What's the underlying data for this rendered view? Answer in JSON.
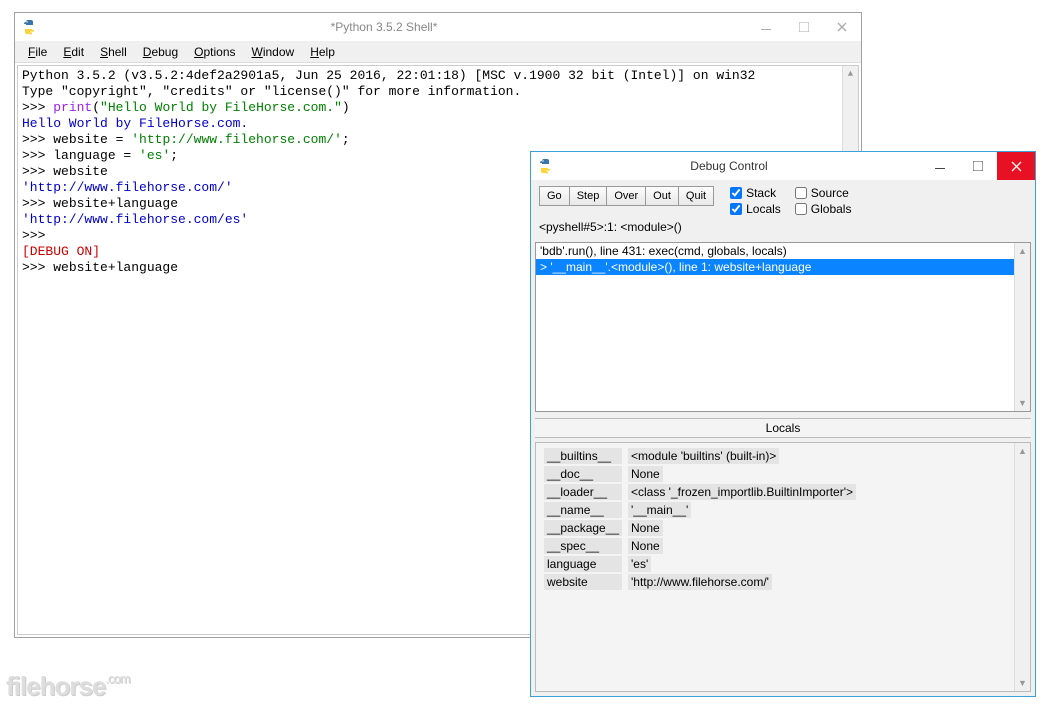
{
  "shell_window": {
    "title": "*Python 3.5.2 Shell*",
    "menus": [
      "File",
      "Edit",
      "Shell",
      "Debug",
      "Options",
      "Window",
      "Help"
    ],
    "lines": [
      [
        {
          "t": "Python 3.5.2 (v3.5.2:4def2a2901a5, Jun 25 2016, 22:01:18) [MSC v.1900 32 bit (Intel)] on win32",
          "c": ""
        }
      ],
      [
        {
          "t": "Type \"copyright\", \"credits\" or \"license()\" for more information.",
          "c": ""
        }
      ],
      [
        {
          "t": ">>> ",
          "c": "prompt"
        },
        {
          "t": "print",
          "c": "func"
        },
        {
          "t": "(",
          "c": ""
        },
        {
          "t": "\"Hello World by FileHorse.com.\"",
          "c": "str"
        },
        {
          "t": ")",
          "c": ""
        }
      ],
      [
        {
          "t": "Hello World by FileHorse.com.",
          "c": "out-blue"
        }
      ],
      [
        {
          "t": ">>> ",
          "c": "prompt"
        },
        {
          "t": "website = ",
          "c": ""
        },
        {
          "t": "'http://www.filehorse.com/'",
          "c": "str"
        },
        {
          "t": ";",
          "c": ""
        }
      ],
      [
        {
          "t": ">>> ",
          "c": "prompt"
        },
        {
          "t": "language = ",
          "c": ""
        },
        {
          "t": "'es'",
          "c": "str"
        },
        {
          "t": ";",
          "c": ""
        }
      ],
      [
        {
          "t": ">>> ",
          "c": "prompt"
        },
        {
          "t": "website",
          "c": ""
        }
      ],
      [
        {
          "t": "'http://www.filehorse.com/'",
          "c": "out-blue"
        }
      ],
      [
        {
          "t": ">>> ",
          "c": "prompt"
        },
        {
          "t": "website+language",
          "c": ""
        }
      ],
      [
        {
          "t": "'http://www.filehorse.com/es'",
          "c": "out-blue"
        }
      ],
      [
        {
          "t": ">>> ",
          "c": "prompt"
        }
      ],
      [
        {
          "t": "[DEBUG ON]",
          "c": "out-red"
        }
      ],
      [
        {
          "t": ">>> ",
          "c": "prompt"
        },
        {
          "t": "website+language",
          "c": ""
        }
      ]
    ]
  },
  "debug_window": {
    "title": "Debug Control",
    "buttons": [
      "Go",
      "Step",
      "Over",
      "Out",
      "Quit"
    ],
    "checks": {
      "stack": true,
      "source": false,
      "locals": true,
      "globals": false
    },
    "check_labels": {
      "stack": "Stack",
      "source": "Source",
      "locals": "Locals",
      "globals": "Globals"
    },
    "status": "<pyshell#5>:1: <module>()",
    "frames": [
      "'bdb'.run(), line 431: exec(cmd, globals, locals)",
      "> '__main__'.<module>(), line 1: website+language"
    ],
    "locals_header": "Locals",
    "locals": [
      {
        "k": "__builtins__",
        "v": "<module 'builtins' (built-in)>"
      },
      {
        "k": "__doc__",
        "v": "None"
      },
      {
        "k": "__loader__",
        "v": "<class '_frozen_importlib.BuiltinImporter'>"
      },
      {
        "k": "__name__",
        "v": "'__main__'"
      },
      {
        "k": "__package__",
        "v": "None"
      },
      {
        "k": "__spec__",
        "v": "None"
      },
      {
        "k": "language",
        "v": "'es'"
      },
      {
        "k": "website",
        "v": "'http://www.filehorse.com/'"
      }
    ]
  },
  "watermark": "filehorse",
  "watermark_suffix": ".com"
}
